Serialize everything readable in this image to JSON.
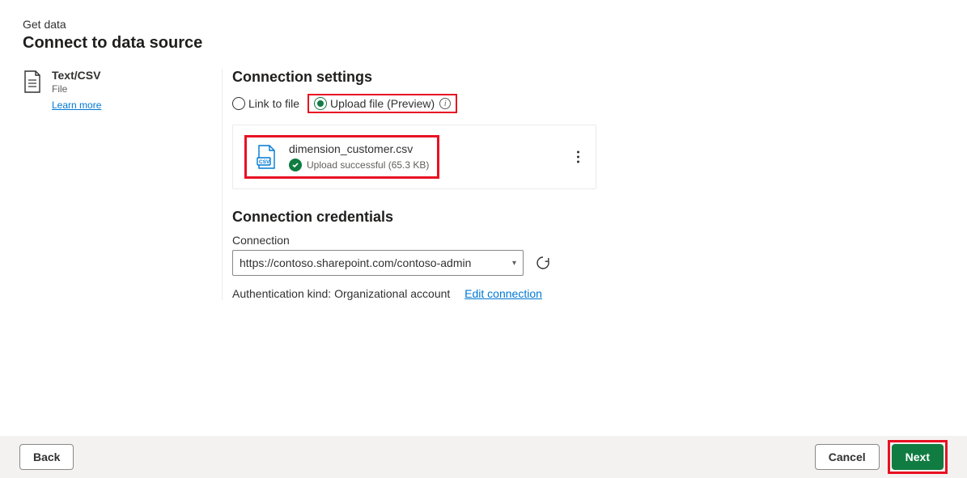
{
  "header": {
    "breadcrumb": "Get data",
    "title": "Connect to data source"
  },
  "sidebar": {
    "source_name": "Text/CSV",
    "source_subtitle": "File",
    "learn_more": "Learn more"
  },
  "settings": {
    "title": "Connection settings",
    "radio_link_label": "Link to file",
    "radio_upload_label": "Upload file (Preview)",
    "file_name": "dimension_customer.csv",
    "upload_status": "Upload successful (65.3 KB)"
  },
  "credentials": {
    "title": "Connection credentials",
    "connection_label": "Connection",
    "connection_value": "https://contoso.sharepoint.com/contoso-admin",
    "auth_line": "Authentication kind: Organizational account",
    "edit_link": "Edit connection"
  },
  "footer": {
    "back": "Back",
    "cancel": "Cancel",
    "next": "Next"
  },
  "colors": {
    "accent_green": "#107c41",
    "highlight_red": "#e81123",
    "link_blue": "#0078d4"
  }
}
